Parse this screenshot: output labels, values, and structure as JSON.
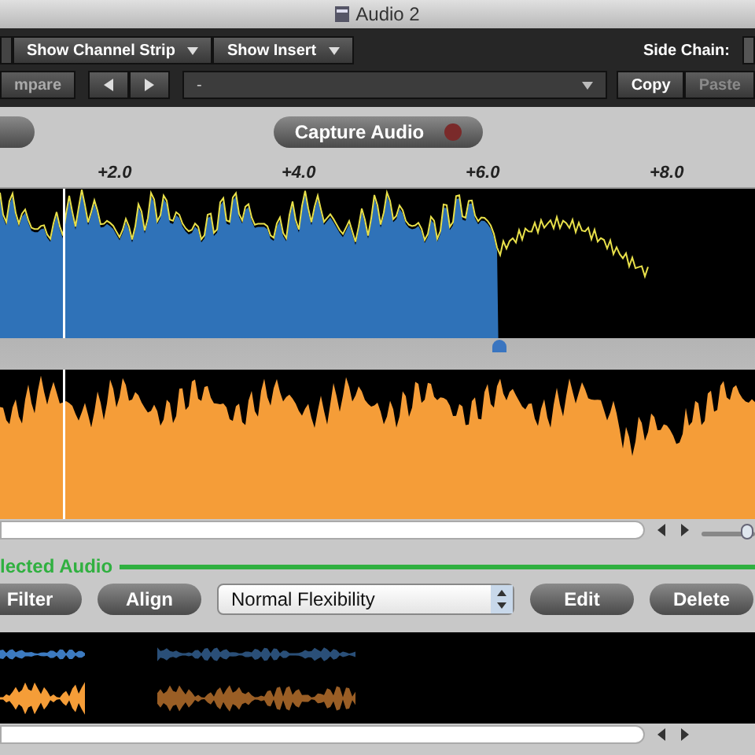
{
  "window": {
    "title": "Audio 2"
  },
  "toolbar": {
    "menus": [
      {
        "label": "Show Channel Strip"
      },
      {
        "label": "Show Insert"
      }
    ],
    "side_chain_label": "Side Chain:",
    "compare": "mpare",
    "preset": "-",
    "buttons": [
      {
        "label": "Copy",
        "disabled": false
      },
      {
        "label": "Paste",
        "disabled": true
      }
    ]
  },
  "capture_button": {
    "label": "Capture Audio"
  },
  "ruler": {
    "marks": [
      "+2.0",
      "+4.0",
      "+6.0",
      "+8.0"
    ]
  },
  "trim": {
    "level": 0.66
  },
  "section": {
    "title": "lected Audio"
  },
  "actions": [
    {
      "kind": "button",
      "label": "Filter"
    },
    {
      "kind": "button",
      "label": "Align"
    },
    {
      "kind": "select",
      "label": "Normal Flexibility"
    },
    {
      "kind": "button",
      "label": "Edit"
    },
    {
      "kind": "button",
      "label": "Delete"
    }
  ],
  "zoom": {
    "level": 0.85
  }
}
